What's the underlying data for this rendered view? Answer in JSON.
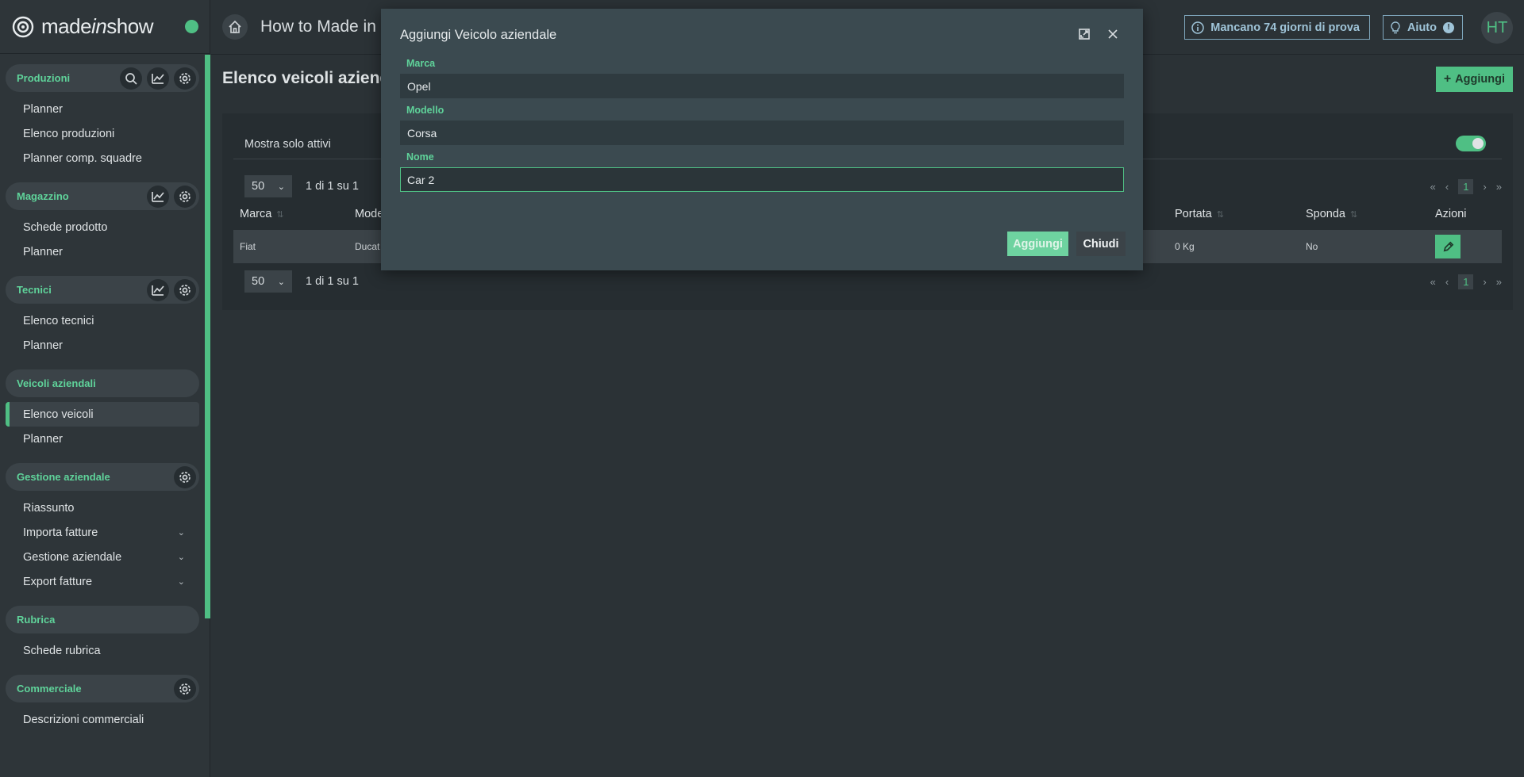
{
  "brand": {
    "prefix": "made",
    "mid": "in",
    "suffix": "show"
  },
  "topbar": {
    "title": "How to Made in S",
    "trial": "Mancano 74 giorni di prova",
    "help": "Aiuto",
    "help_badge": "!",
    "avatar": "HT"
  },
  "sidebar": {
    "sections": [
      {
        "title": "Produzioni",
        "items": [
          "Planner",
          "Elenco produzioni",
          "Planner comp. squadre"
        ]
      },
      {
        "title": "Magazzino",
        "items": [
          "Schede prodotto",
          "Planner"
        ]
      },
      {
        "title": "Tecnici",
        "items": [
          "Elenco tecnici",
          "Planner"
        ]
      },
      {
        "title": "Veicoli aziendali",
        "items": [
          "Elenco veicoli",
          "Planner"
        ]
      },
      {
        "title": "Gestione aziendale",
        "items": [
          "Riassunto",
          "Importa fatture",
          "Gestione aziendale",
          "Export fatture"
        ]
      },
      {
        "title": "Rubrica",
        "items": [
          "Schede rubrica"
        ]
      },
      {
        "title": "Commerciale",
        "items": [
          "Descrizioni commerciali"
        ]
      }
    ]
  },
  "main": {
    "title": "Elenco veicoli aziend",
    "add_label": "Aggiungi",
    "filter_label": "Mostra solo attivi",
    "per_page": "50",
    "count_text": "1 di 1 su 1",
    "page": "1",
    "columns": {
      "marca": "Marca",
      "modello": "Mode",
      "portata": "Portata",
      "sponda": "Sponda",
      "azioni": "Azioni"
    },
    "row": {
      "marca": "Fiat",
      "modello": "Ducat",
      "portata": "0 Kg",
      "sponda": "No"
    }
  },
  "modal": {
    "title": "Aggiungi Veicolo aziendale",
    "fields": {
      "marca_label": "Marca",
      "marca_value": "Opel",
      "modello_label": "Modello",
      "modello_value": "Corsa",
      "nome_label": "Nome",
      "nome_value": "Car 2"
    },
    "add_button": "Aggiungi",
    "close_button": "Chiudi"
  },
  "icons": {
    "search": "search-icon",
    "chart": "chart-icon",
    "gear": "gear-icon",
    "home": "home-icon",
    "info": "info-icon",
    "help": "lightbulb-icon",
    "edit": "pencil-icon",
    "expand": "expand-icon",
    "close": "close-icon"
  },
  "colors": {
    "accent": "#4fbf84",
    "info": "#9fc4d8"
  }
}
